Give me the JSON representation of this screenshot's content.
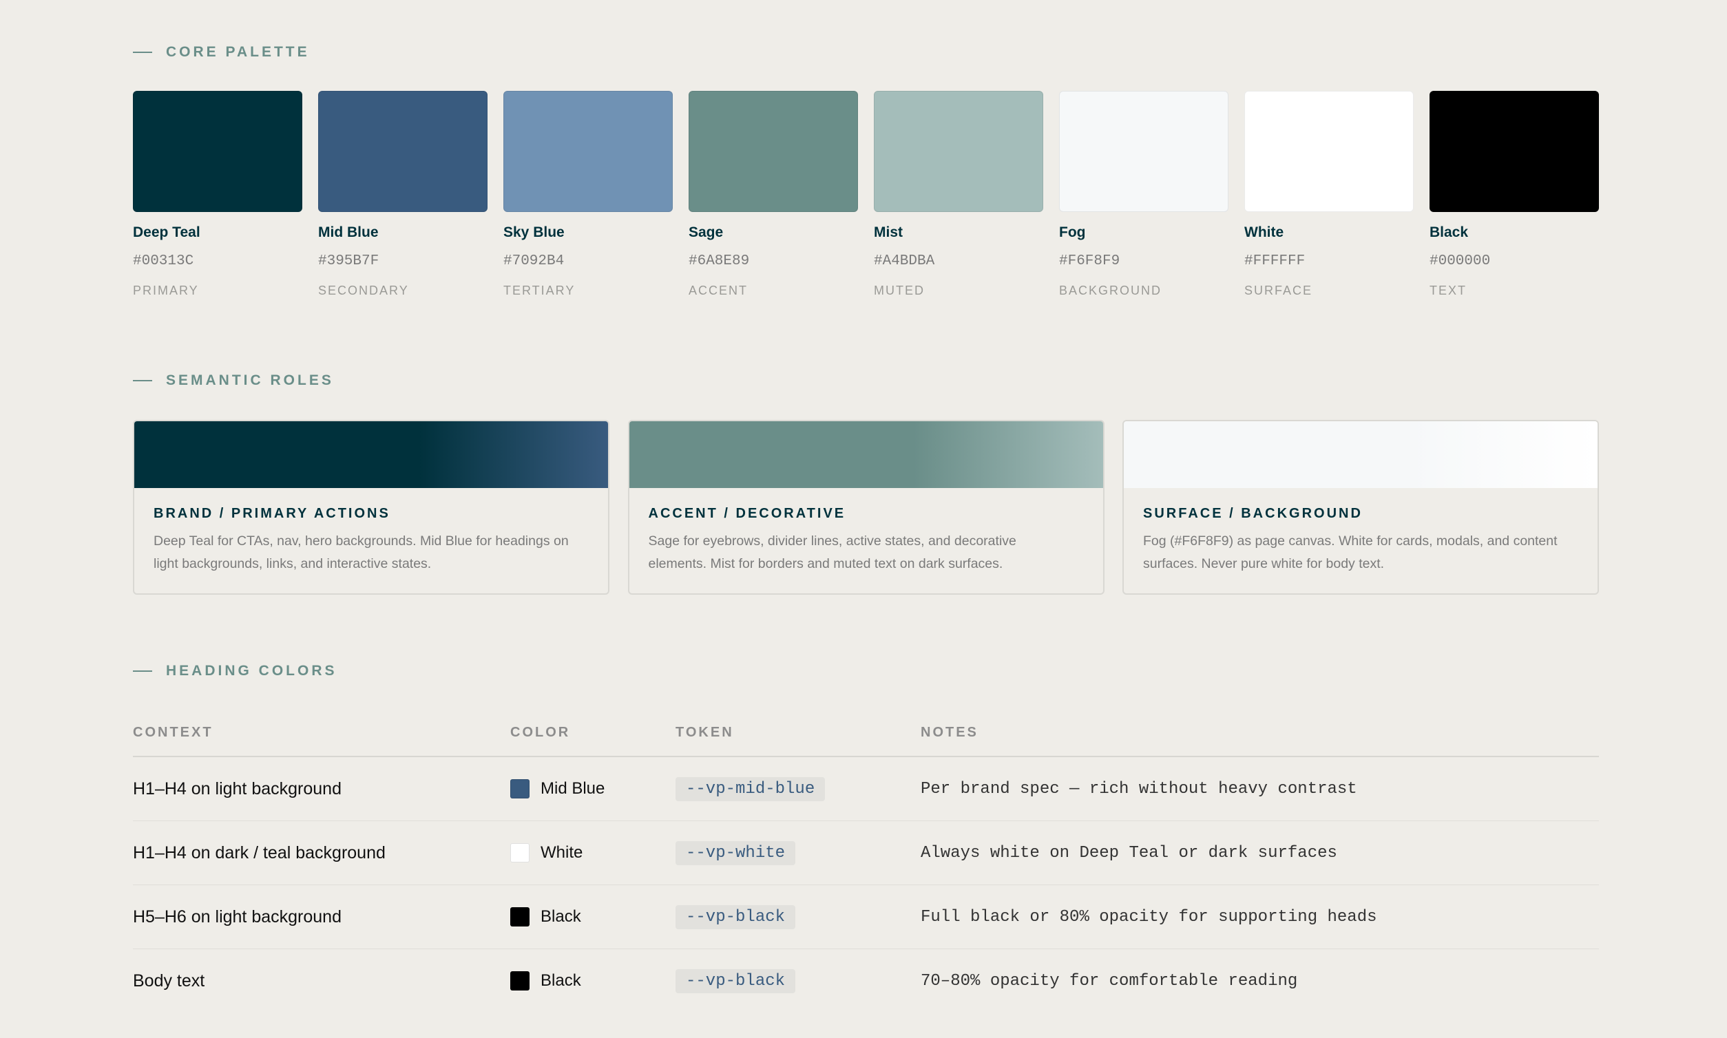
{
  "sections": {
    "core_palette": "CORE PALETTE",
    "semantic_roles": "SEMANTIC ROLES",
    "heading_colors": "HEADING COLORS"
  },
  "palette": [
    {
      "name": "Deep Teal",
      "hex": "#00313C",
      "role": "PRIMARY",
      "color": "#00313C"
    },
    {
      "name": "Mid Blue",
      "hex": "#395B7F",
      "role": "SECONDARY",
      "color": "#395B7F"
    },
    {
      "name": "Sky Blue",
      "hex": "#7092B4",
      "role": "TERTIARY",
      "color": "#7092B4"
    },
    {
      "name": "Sage",
      "hex": "#6A8E89",
      "role": "ACCENT",
      "color": "#6A8E89"
    },
    {
      "name": "Mist",
      "hex": "#A4BDBA",
      "role": "MUTED",
      "color": "#A4BDBA"
    },
    {
      "name": "Fog",
      "hex": "#F6F8F9",
      "role": "BACKGROUND",
      "color": "#F6F8F9"
    },
    {
      "name": "White",
      "hex": "#FFFFFF",
      "role": "SURFACE",
      "color": "#FFFFFF"
    },
    {
      "name": "Black",
      "hex": "#000000",
      "role": "TEXT",
      "color": "#000000"
    }
  ],
  "roles": [
    {
      "title": "BRAND / PRIMARY ACTIONS",
      "desc_line1": "Deep Teal for CTAs, nav, hero backgrounds. Mid Blue for headings on",
      "desc_line2": "light backgrounds, links, and interactive states.",
      "gradient_from": "#00313C",
      "gradient_to": "#395B7F"
    },
    {
      "title": "ACCENT / DECORATIVE",
      "desc_line1": "Sage for eyebrows, divider lines, active states, and decorative",
      "desc_line2": "elements. Mist for borders and muted text on dark surfaces.",
      "gradient_from": "#6A8E89",
      "gradient_to": "#A4BDBA"
    },
    {
      "title": "SURFACE / BACKGROUND",
      "desc_line1": "Fog (#F6F8F9) as page canvas. White for cards, modals, and content",
      "desc_line2": "surfaces. Never pure white for body text.",
      "gradient_from": "#F6F8F9",
      "gradient_to": "#FFFFFF"
    }
  ],
  "table": {
    "headers": {
      "context": "CONTEXT",
      "color": "COLOR",
      "token": "TOKEN",
      "notes": "NOTES"
    },
    "rows": [
      {
        "context": "H1–H4 on light background",
        "color_name": "Mid Blue",
        "swatch": "#395B7F",
        "token": "--vp-mid-blue",
        "notes": "Per brand spec — rich without heavy contrast"
      },
      {
        "context": "H1–H4 on dark / teal background",
        "color_name": "White",
        "swatch": "#FFFFFF",
        "token": "--vp-white",
        "notes": "Always white on Deep Teal or dark surfaces"
      },
      {
        "context": "H5–H6 on light background",
        "color_name": "Black",
        "swatch": "#000000",
        "token": "--vp-black",
        "notes": "Full black or 80% opacity for supporting heads"
      },
      {
        "context": "Body text",
        "color_name": "Black",
        "swatch": "#000000",
        "token": "--vp-black",
        "notes": "70–80% opacity for comfortable reading"
      }
    ]
  }
}
